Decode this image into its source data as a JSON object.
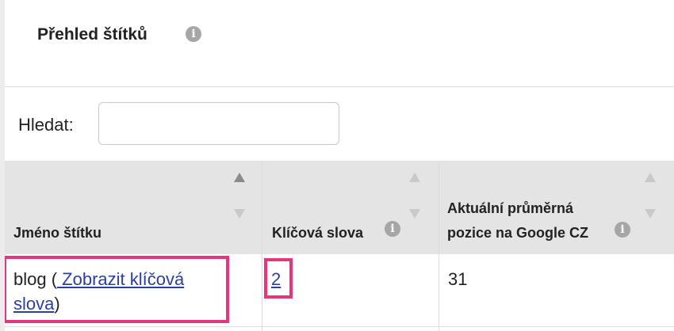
{
  "panel": {
    "title": "Přehled štítků"
  },
  "search": {
    "label": "Hledat:",
    "value": "",
    "placeholder": ""
  },
  "table": {
    "columns": [
      {
        "label": "Jméno štítku"
      },
      {
        "label": "Klíčová slova"
      },
      {
        "label_line1": "Aktuální průměrná",
        "label_line2": "pozice na Google CZ"
      }
    ],
    "rows": [
      {
        "tag_prefix": "blog (",
        "tag_link_line1": " Zobrazit klíčová",
        "tag_link_line2": "slova",
        "tag_suffix": ")",
        "keywords": "2",
        "position": "31"
      }
    ]
  },
  "colors": {
    "highlight": "#e5357f",
    "link": "#2b3ea1",
    "header_bg": "#e4e4e4",
    "sort_active": "#8a8a8a",
    "sort_inactive": "#c9c9c9"
  },
  "icons": {
    "info": "info-icon",
    "sort_asc": "sort-ascending-icon",
    "sort_desc": "sort-descending-icon"
  }
}
